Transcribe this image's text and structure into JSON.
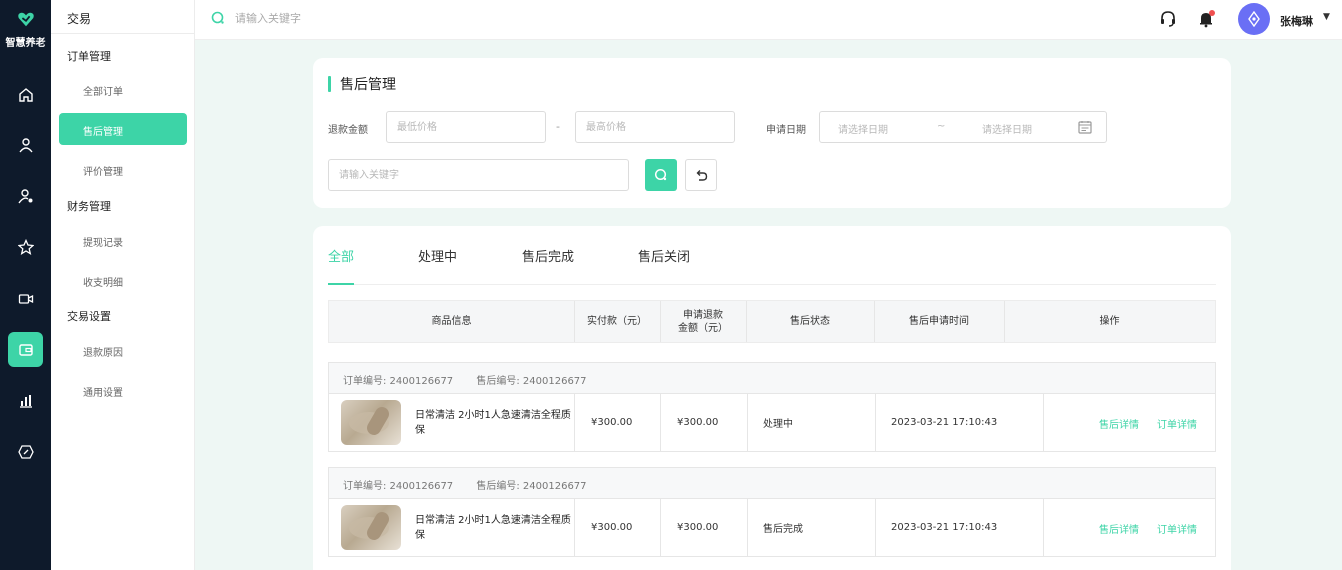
{
  "brand": {
    "name": "智慧养老"
  },
  "rail": {
    "icons": [
      "home-icon",
      "user-icon",
      "user-check-icon",
      "star-icon",
      "video-icon",
      "wallet-icon",
      "chart-icon",
      "tag-icon"
    ]
  },
  "subnav": {
    "top": "交易",
    "groups": [
      "订单管理",
      "财务管理",
      "交易设置"
    ],
    "items": [
      "全部订单",
      "售后管理",
      "评价管理",
      "提现记录",
      "收支明细",
      "退款原因",
      "通用设置"
    ],
    "active": "售后管理"
  },
  "topbar": {
    "search_placeholder": "请输入关键字",
    "user_name": "张梅琳",
    "caret": "▼",
    "notification_dot": "#f05050"
  },
  "filter": {
    "title": "售后管理",
    "refund_label": "退款金额",
    "min_price_placeholder": "最低价格",
    "max_price_placeholder": "最高价格",
    "range_sep": "-",
    "date_label": "申请日期",
    "date_start_placeholder": "请选择日期",
    "date_sep": "~",
    "date_end_placeholder": "请选择日期",
    "keyword_placeholder": "请输入关键字"
  },
  "tabs": [
    "全部",
    "处理中",
    "售后完成",
    "售后关闭"
  ],
  "table": {
    "headers": {
      "product": "商品信息",
      "paid": "实付款（元）",
      "refund_line1": "申请退款",
      "refund_line2": "金额（元）",
      "status": "售后状态",
      "time": "售后申请时间",
      "ops": "操作"
    },
    "orders": [
      {
        "order_no": "订单编号: 2400126677",
        "aftersale_no": "售后编号: 2400126677",
        "product": "日常清洁 2小时1人急速清洁全程质保",
        "paid": "¥300.00",
        "refund": "¥300.00",
        "status": "处理中",
        "time": "2023-03-21 17:10:43",
        "op1": "售后详情",
        "op2": "订单详情"
      },
      {
        "order_no": "订单编号: 2400126677",
        "aftersale_no": "售后编号: 2400126677",
        "product": "日常清洁 2小时1人急速清洁全程质保",
        "paid": "¥300.00",
        "refund": "¥300.00",
        "status": "售后完成",
        "time": "2023-03-21 17:10:43",
        "op1": "售后详情",
        "op2": "订单详情"
      }
    ]
  },
  "colors": {
    "accent": "#3dd4a7",
    "rail_bg": "#0e1a2b",
    "avatar_bg": "#6a6ff5"
  }
}
